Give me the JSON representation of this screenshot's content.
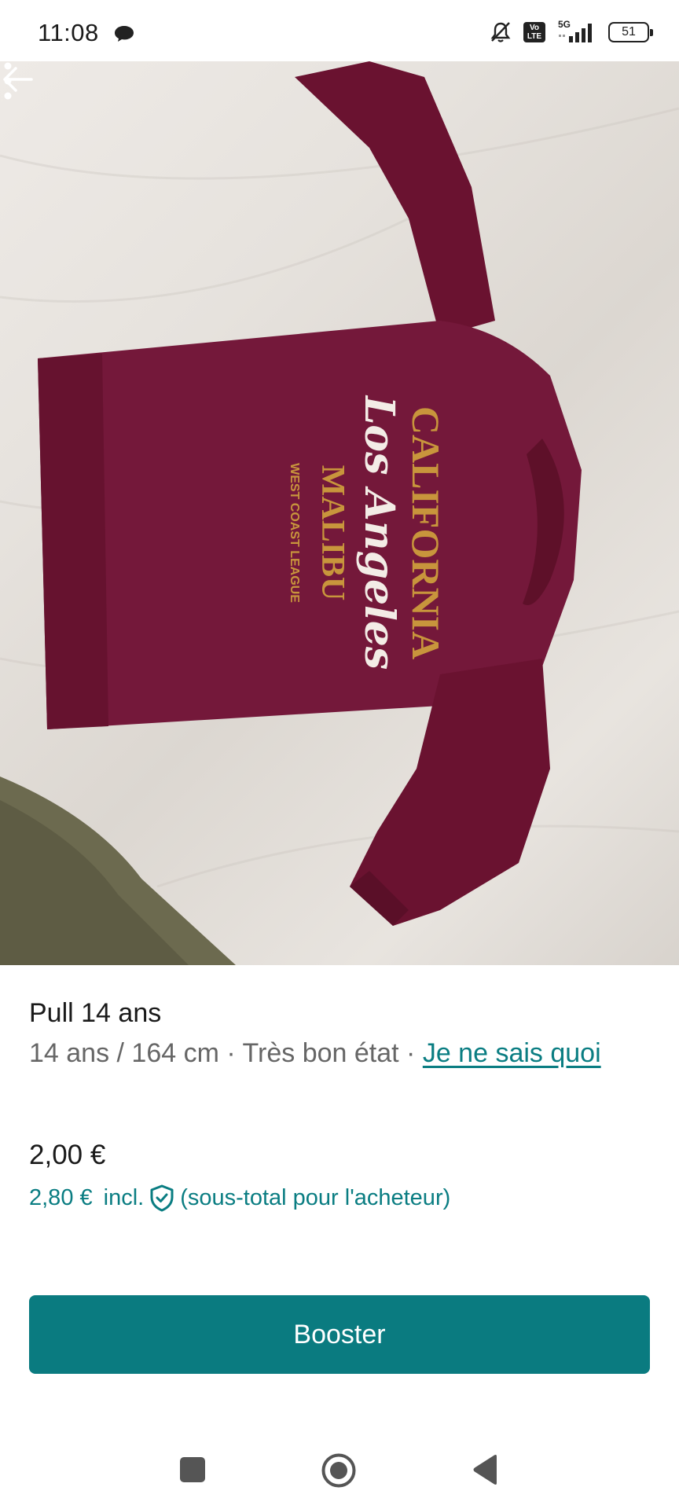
{
  "status_bar": {
    "time": "11:08",
    "network": "5G",
    "volte_label": "Vo LTE",
    "battery": "51"
  },
  "photo": {
    "print_lines": [
      "CALIFORNIA",
      "Los Angeles",
      "MALIBU",
      "WEST COAST LEAGUE"
    ]
  },
  "listing": {
    "title": "Pull 14 ans",
    "size": "14 ans / 164 cm",
    "separator": " · ",
    "condition": "Très bon état",
    "brand_link": "Je ne sais quoi",
    "price": "2,00 €",
    "buyer_price": "2,80 €",
    "buyer_incl": "incl.",
    "buyer_note": "(sous-total pour l'acheteur)"
  },
  "actions": {
    "booster_label": "Booster"
  },
  "colors": {
    "accent": "#0a7b80",
    "sweater": "#6e1530",
    "print_gold": "#c8953c"
  }
}
